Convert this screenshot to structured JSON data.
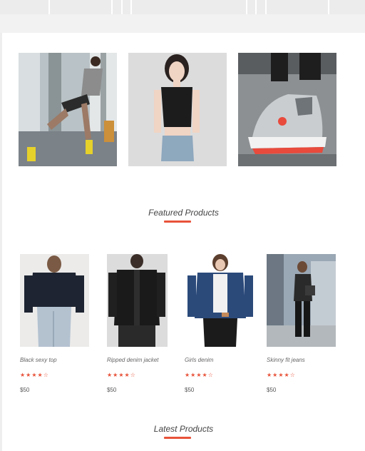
{
  "banners": [
    {
      "alt": "man-exercising-photo"
    },
    {
      "alt": "woman-black-top-photo"
    },
    {
      "alt": "sneaker-photo"
    }
  ],
  "featured": {
    "title": "Featured Products",
    "products": [
      {
        "name": "Black sexy top",
        "rating": "★★★★☆",
        "price": "$50"
      },
      {
        "name": "Ripped denim jacket",
        "rating": "★★★★☆",
        "price": "$50"
      },
      {
        "name": "Girls denim",
        "rating": "★★★★☆",
        "price": "$50"
      },
      {
        "name": "Skinny fit jeans",
        "rating": "★★★★☆",
        "price": "$50"
      }
    ]
  },
  "latest": {
    "title": "Latest Products"
  },
  "colors": {
    "accent": "#e8533a"
  }
}
